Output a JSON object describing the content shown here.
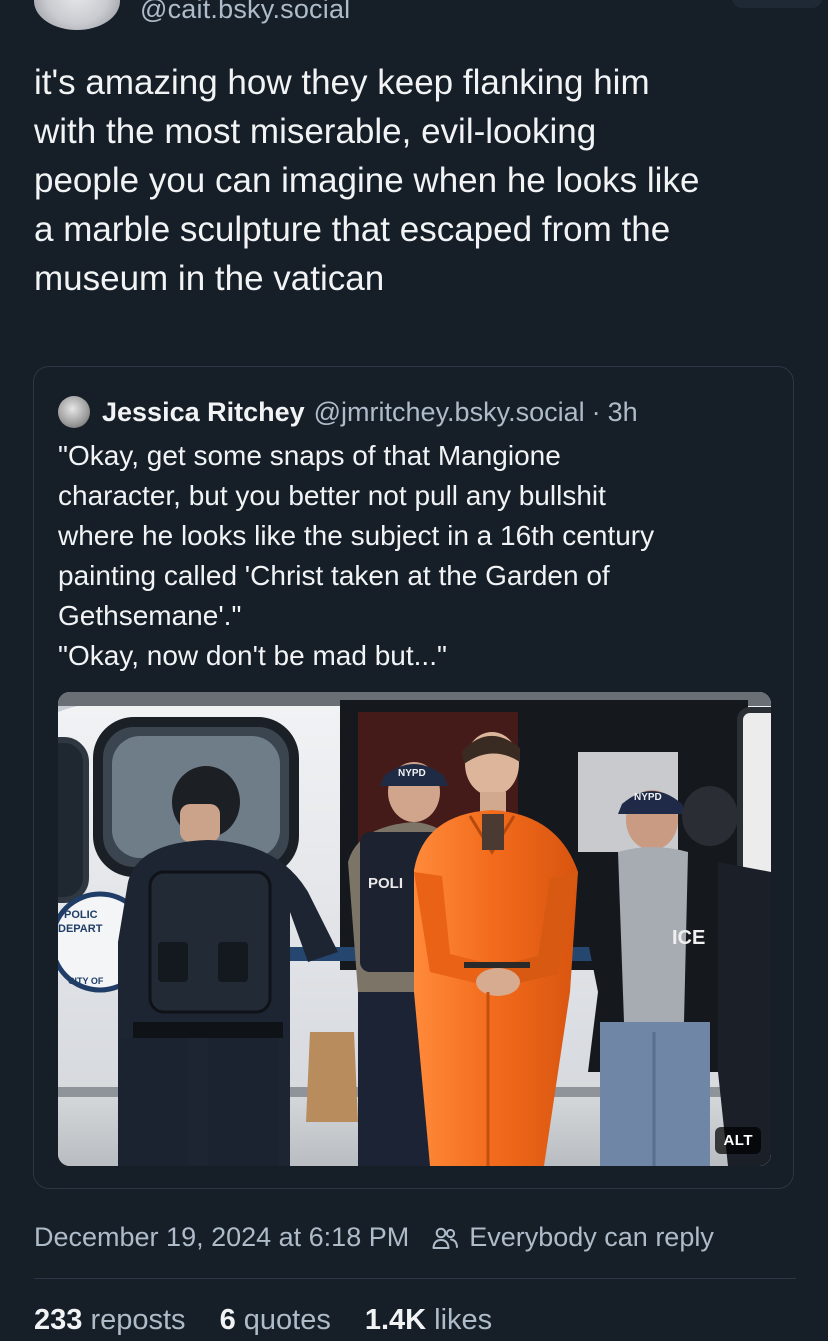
{
  "post": {
    "handle": "@cait.bsky.social",
    "text": "it's amazing how they keep flanking him\nwith the most miserable, evil-looking\npeople you can imagine when he looks like\na marble sculpture that escaped from the\nmuseum in the vatican"
  },
  "quote": {
    "author_name": "Jessica Ritchey",
    "author_handle": "@jmritchey.bsky.social",
    "separator": "·",
    "time": "3h",
    "text": "\"Okay, get some snaps of that Mangione\ncharacter, but you better not pull any bullshit\nwhere he looks like the subject in a 16th century\npainting called 'Christ taken at the Garden of\nGethsemane'.\"\n\"Okay, now don't be mad but...\"",
    "image": {
      "alt_badge": "ALT",
      "cap_text_left": "NYPD",
      "cap_text_right": "NYPD",
      "vest_text": "POLI",
      "jacket_text": "ICE",
      "door_text_1": "POLIC",
      "door_text_2": "DEPART",
      "door_text_3": "CITY OF"
    }
  },
  "meta": {
    "timestamp": "December 19, 2024 at 6:18 PM",
    "reply_setting": "Everybody can reply",
    "reply_icon": "people-icon"
  },
  "stats": [
    {
      "count": "233",
      "label": "reposts"
    },
    {
      "count": "6",
      "label": "quotes"
    },
    {
      "count": "1.4K",
      "label": "likes"
    }
  ],
  "colors": {
    "background": "#161e27",
    "text_primary": "#f1f3f5",
    "text_secondary": "#aebbc9",
    "border": "#2b3744",
    "jumpsuit": "#f26a1b"
  }
}
